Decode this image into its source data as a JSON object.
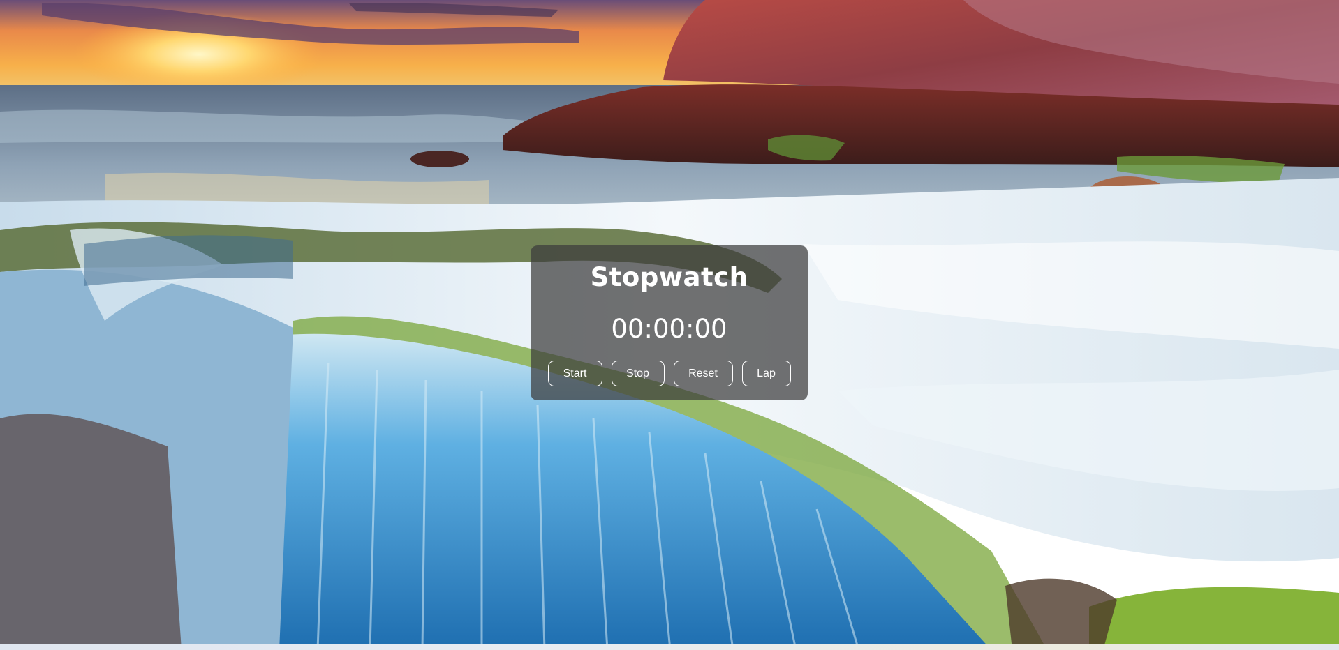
{
  "stopwatch": {
    "title": "Stopwatch",
    "time": "00:00:00",
    "buttons": {
      "start": "Start",
      "stop": "Stop",
      "reset": "Reset",
      "lap": "Lap"
    }
  },
  "colors": {
    "panel_bg": "#3c3c3cb8",
    "text": "#ffffff",
    "sky_top": "#3a2a4a",
    "sunset": "#f5a640",
    "sea": "#6d8aa8",
    "water_foam": "#e6f1f8",
    "waterfall": "#3f8fcf",
    "rock": "#7a3a3a",
    "moss": "#7aa63a"
  },
  "background": {
    "scene": "seascape-waterfall-sunset"
  }
}
